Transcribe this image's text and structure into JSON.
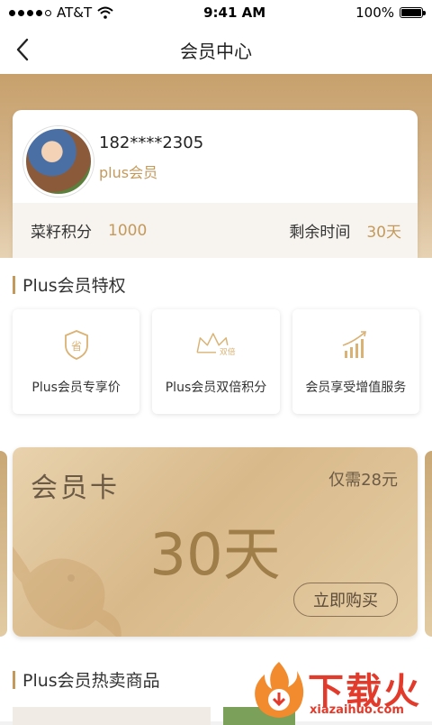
{
  "status_bar": {
    "carrier": "AT&T",
    "time": "9:41 AM",
    "battery": "100%",
    "battery_level": 1.0
  },
  "nav": {
    "title": "会员中心",
    "back_icon": "chevron-left-icon"
  },
  "profile": {
    "phone": "182****2305",
    "level": "plus会员"
  },
  "stats": {
    "points_label": "菜籽积分",
    "points_value": "1000",
    "remaining_label": "剩余时间",
    "remaining_value": "30天"
  },
  "privileges": {
    "title": "Plus会员特权",
    "items": [
      {
        "label": "Plus会员专享价",
        "icon": "shield-save-icon"
      },
      {
        "label": "Plus会员双倍积分",
        "icon": "crown-double-icon",
        "badge": "双倍"
      },
      {
        "label": "会员享受增值服务",
        "icon": "growth-chart-icon"
      }
    ]
  },
  "member_card": {
    "title": "会员卡",
    "price": "仅需28元",
    "days": "30天",
    "buy_label": "立即购买"
  },
  "hot_products": {
    "title": "Plus会员热卖商品"
  },
  "watermark": {
    "text": "下载火",
    "sub": "xiazaihuo.com"
  },
  "colors": {
    "accent": "#c49a5c",
    "card_gold": "#d8b98a",
    "watermark": "#e23b2b"
  }
}
